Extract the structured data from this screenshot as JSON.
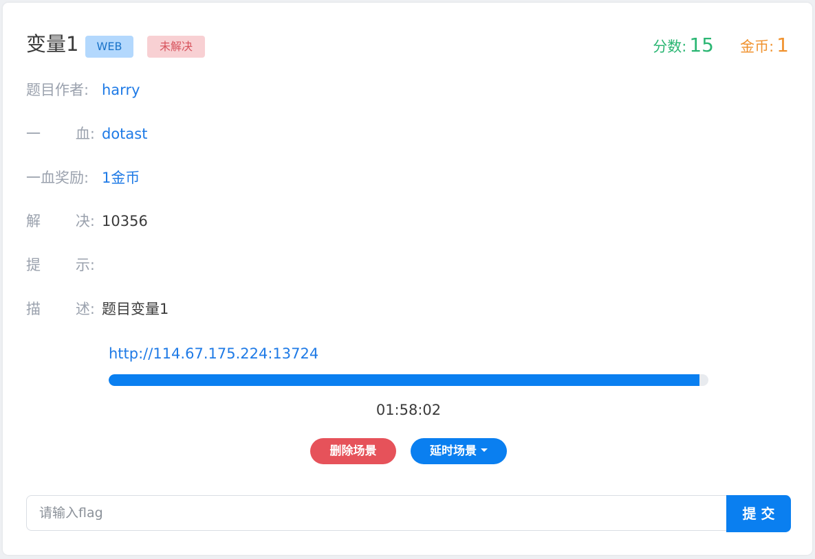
{
  "challenge": {
    "title": "变量1",
    "category_badge": "WEB",
    "status_badge": "未解决",
    "score_label": "分数:",
    "score_value": "15",
    "coin_label": "金币:",
    "coin_value": "1"
  },
  "fields": [
    {
      "label_a": "题目作者:",
      "label_b": "",
      "value": "harry"
    },
    {
      "label_a": "一",
      "label_b": "血:",
      "value": "dotast"
    },
    {
      "label_a": "一血奖励:",
      "label_b": "",
      "value": "1金币"
    },
    {
      "label_a": "解",
      "label_b": "决:",
      "value": "10356"
    },
    {
      "label_a": "提",
      "label_b": "示:",
      "value": ""
    },
    {
      "label_a": "描",
      "label_b": "述:",
      "value": "题目变量1"
    }
  ],
  "scene": {
    "url": "http://114.67.175.224:13724",
    "progress_fraction": 0.985,
    "timer": "01:58:02",
    "delete_button": "删除场景",
    "delay_button": "延时场景"
  },
  "flag_form": {
    "placeholder": "请输入flag",
    "value": "",
    "submit_label": "提 交"
  },
  "colors": {
    "primary": "#0a7ff0",
    "danger": "#e6525a",
    "score": "#2bb673",
    "coin": "#f0922e"
  }
}
